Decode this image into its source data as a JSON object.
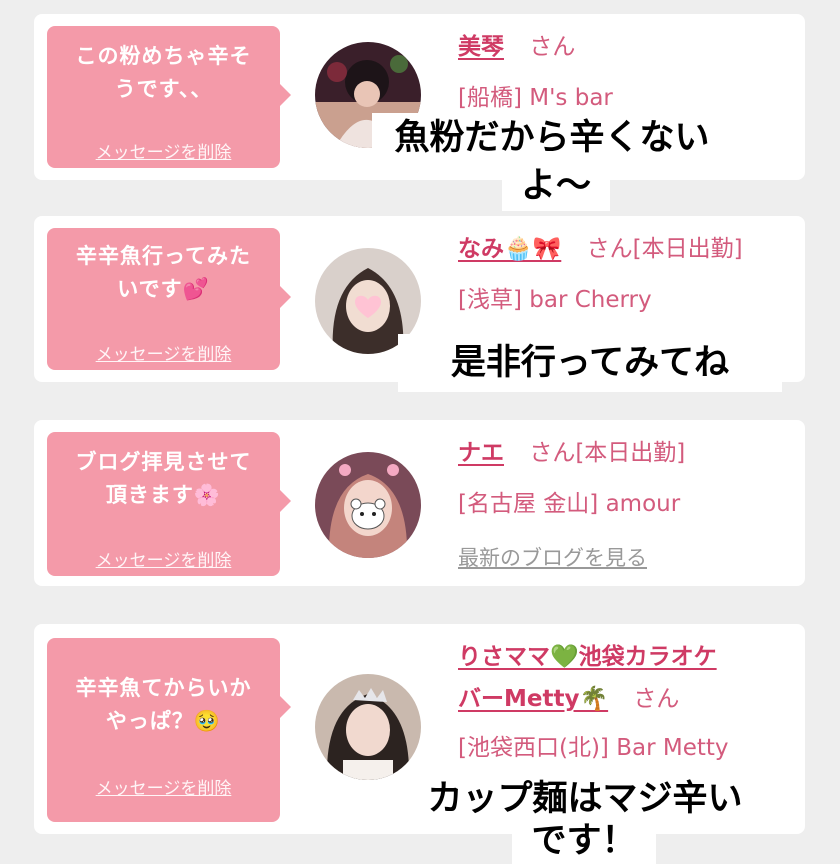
{
  "messages": [
    {
      "message_lines": [
        "この粉めちゃ辛そ",
        "うです、、"
      ],
      "delete_label": "メッセージを削除",
      "name": "美琴",
      "name_suffix": "さん",
      "shop": "[船橋] M's bar"
    },
    {
      "message_lines": [
        "辛辛魚行ってみた",
        "いです💕"
      ],
      "delete_label": "メッセージを削除",
      "name": "なみ🧁🎀",
      "name_suffix": "さん[本日出勤]",
      "shop": "[浅草] bar Cherry"
    },
    {
      "message_lines": [
        "ブログ拝見させて",
        "頂きます🌸"
      ],
      "delete_label": "メッセージを削除",
      "name": "ナエ",
      "name_suffix": "さん[本日出勤]",
      "shop": "[名古屋 金山] amour",
      "blog_link": "最新のブログを見る"
    },
    {
      "message_lines": [
        "辛辛魚てからいか",
        "やっぱ？🥹"
      ],
      "delete_label": "メッセージを削除",
      "name_line1": "りさママ💚池袋カラオケ",
      "name_line2": "バーMetty🌴",
      "name_suffix": "さん",
      "shop": "[池袋西口(北)] Bar Metty"
    }
  ],
  "overlays": {
    "reply1_line1": "魚粉だから辛くない",
    "reply1_line2": "よ〜",
    "reply2": "是非行ってみてね",
    "reply3_line1": "カップ麺はマジ辛い",
    "reply3_line2": "です！"
  },
  "colors": {
    "bubble": "#f49aa9",
    "name": "#cf3a64",
    "shop": "#d35b7d",
    "background": "#eeeeee"
  }
}
